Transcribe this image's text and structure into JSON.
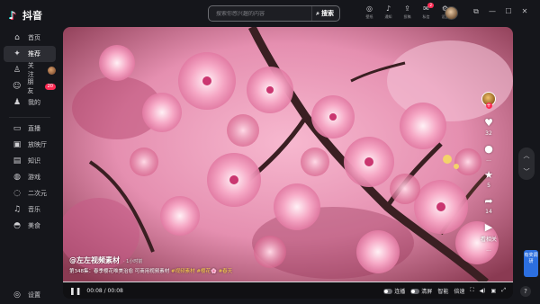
{
  "app": {
    "name": "抖音"
  },
  "sidebar": {
    "items": [
      {
        "label": "首页",
        "icon": "home-icon",
        "glyph": "⌂"
      },
      {
        "label": "推荐",
        "icon": "sparkle-icon",
        "glyph": "✦",
        "active": true
      },
      {
        "label": "关注",
        "icon": "follow-icon",
        "glyph": "♙"
      },
      {
        "label": "朋友",
        "icon": "friends-icon",
        "glyph": "☺",
        "badge": "20"
      },
      {
        "label": "我的",
        "icon": "profile-icon",
        "glyph": "♟"
      },
      {
        "label": "直播",
        "icon": "live-icon",
        "glyph": "▭"
      },
      {
        "label": "放映厅",
        "icon": "cinema-icon",
        "glyph": "▣"
      },
      {
        "label": "知识",
        "icon": "knowledge-icon",
        "glyph": "▤"
      },
      {
        "label": "游戏",
        "icon": "game-icon",
        "glyph": "◍"
      },
      {
        "label": "二次元",
        "icon": "anime-icon",
        "glyph": "◌"
      },
      {
        "label": "音乐",
        "icon": "music-icon",
        "glyph": "♫"
      },
      {
        "label": "美食",
        "icon": "food-icon",
        "glyph": "◓"
      }
    ],
    "settings_label": "设置"
  },
  "search": {
    "placeholder": "搜索你感兴趣的内容",
    "button_label": "搜索"
  },
  "header": {
    "items": [
      {
        "label": "壁纸",
        "icon": "wallpaper-icon",
        "glyph": "◎"
      },
      {
        "label": "通知",
        "icon": "bell-icon",
        "glyph": "♪"
      },
      {
        "label": "投稿",
        "icon": "upload-icon",
        "glyph": "⇪"
      },
      {
        "label": "私信",
        "icon": "message-icon",
        "glyph": "✉",
        "badge": "2"
      },
      {
        "label": "设置",
        "icon": "gear-icon",
        "glyph": "⚙"
      }
    ]
  },
  "window_controls": [
    "⧉",
    "—",
    "☐",
    "✕"
  ],
  "video": {
    "author": "@左左视频素材",
    "posted": "· 1小时前",
    "description_prefix": "第348集：春季樱花唯美治愈 可商用视频素材 ",
    "tags": [
      "#视频素材",
      "#樱花🌸",
      "#春天"
    ],
    "time_current": "00:08",
    "time_total": "00:08",
    "progress": 1.0
  },
  "actions": {
    "likes": "32",
    "comments": "...",
    "favorites": "5",
    "shares": "14",
    "related_label": "看相关",
    "more": "..."
  },
  "controls": {
    "autoplay_label": "连播",
    "clear_label": "清屏",
    "quality_label": "智能",
    "speed_label": "倍速"
  },
  "feedback_label": "有奖调研",
  "help_label": "?"
}
